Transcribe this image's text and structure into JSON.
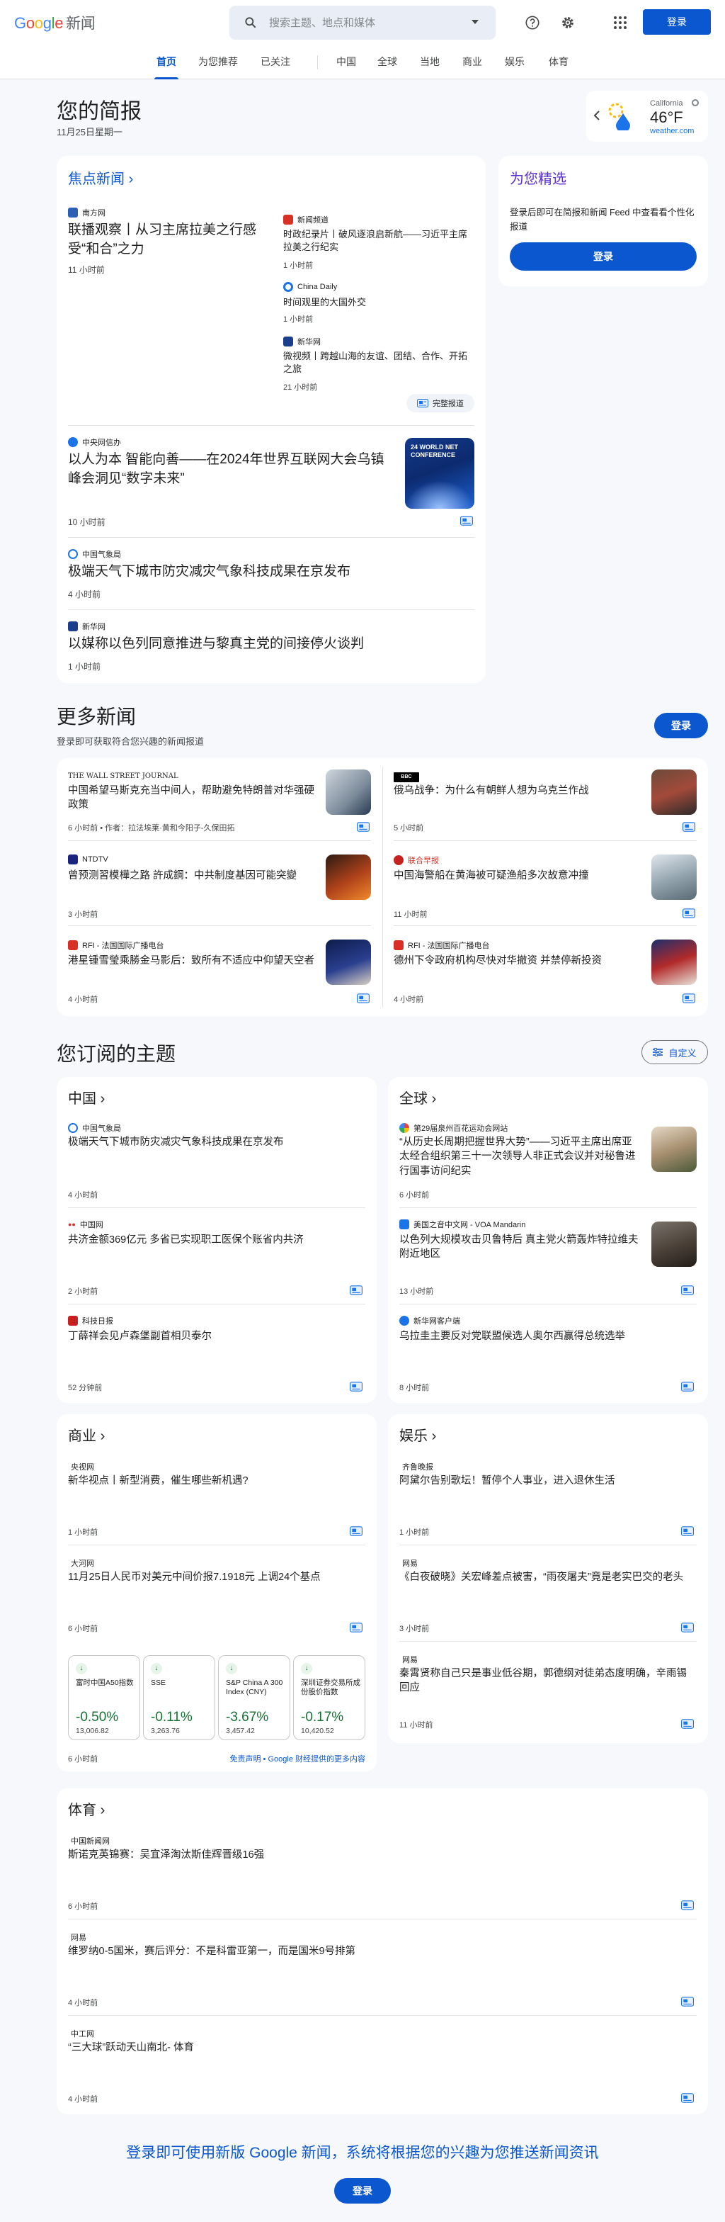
{
  "header": {
    "logo_letters": [
      "G",
      "o",
      "o",
      "g",
      "l",
      "e"
    ],
    "logo_suffix": "新闻",
    "search_placeholder": "搜索主题、地点和媒体",
    "login_label": "登录",
    "icons": [
      "search-icon",
      "help-icon",
      "gear-icon",
      "apps-icon",
      "chevron-down-icon"
    ]
  },
  "nav": {
    "tabs": [
      "首页",
      "为您推荐",
      "已关注",
      "中国",
      "全球",
      "当地",
      "商业",
      "娱乐",
      "体育"
    ],
    "active": "首页"
  },
  "briefing": {
    "title": "您的简报",
    "date": "11月25日星期一",
    "weather": {
      "location": "California",
      "temp": "46°F",
      "source": "weather.com"
    }
  },
  "top_stories": {
    "title": "焦点新闻",
    "full_coverage": "完整报道",
    "cluster": {
      "main": {
        "source": "南方网",
        "headline": "联播观察丨从习主席拉美之行感受“和合”之力",
        "time": "11 小时前"
      },
      "side": [
        {
          "source": "新闻频道",
          "headline": "时政纪录片丨破风逐浪启新航——习近平主席拉美之行纪实",
          "time": "1 小时前"
        },
        {
          "source": "China Daily",
          "headline": "时间观里的大国外交",
          "time": "1 小时前"
        },
        {
          "source": "新华网",
          "headline": "微视频丨跨越山海的友谊、团结、合作、开拓之旅",
          "time": "21 小时前"
        }
      ]
    },
    "stories": [
      {
        "source": "中央网信办",
        "headline": "以人为本 智能向善——在2024年世界互联网大会乌镇峰会洞见“数字未来”",
        "time": "10 小时前",
        "thumb_text": "24 WORLD NET CONFERENCE"
      },
      {
        "source": "中国气象局",
        "headline": "极端天气下城市防灾减灾气象科技成果在京发布",
        "time": "4 小时前"
      },
      {
        "source": "新华网",
        "headline": "以媒称以色列同意推进与黎真主党的间接停火谈判",
        "time": "1 小时前"
      }
    ]
  },
  "for_you": {
    "title": "为您精选",
    "text": "登录后即可在简报和新闻 Feed 中查看看个性化报道",
    "button": "登录"
  },
  "more_news": {
    "title": "更多新闻",
    "subtitle": "登录即可获取符合您兴趣的新闻报道",
    "button": "登录",
    "items": [
      {
        "source": "THE WALL STREET JOURNAL",
        "headline": "中国希望马斯克充当中间人，帮助避免特朗普对华强硬政策",
        "time": "6 小时前",
        "byline": "作者：拉法埃莱·黄和今阳子-久保田拓"
      },
      {
        "source": "BBC",
        "headline": "俄乌战争：为什么有朝鲜人想为乌克兰作战",
        "time": "5 小时前"
      },
      {
        "source": "NTDTV",
        "headline": "曾预测習模樺之路 許成鋼：中共制度基因可能突變",
        "time": "3 小时前"
      },
      {
        "source": "联合早报",
        "headline": "中国海警船在黄海被可疑渔船多次故意冲撞",
        "time": "11 小时前"
      },
      {
        "source": "RFI - 法国国际广播电台",
        "headline": "港星锺雪瑩乘勝金马影后：致所有不适应中仰望天空者",
        "time": "4 小时前"
      },
      {
        "source": "RFI - 法国国际广播电台",
        "headline": "德州下令政府机构尽快对华撤资 并禁停新投资",
        "time": "4 小时前"
      }
    ]
  },
  "topics": {
    "title": "您订阅的主题",
    "customize": "自定义",
    "china": {
      "title": "中国",
      "items": [
        {
          "source": "中国气象局",
          "headline": "极端天气下城市防灾减灾气象科技成果在京发布",
          "time": "4 小时前"
        },
        {
          "source": "中国网",
          "headline": "共济金额369亿元 多省已实现职工医保个账省内共济",
          "time": "2 小时前"
        },
        {
          "source": "科技日报",
          "headline": "丁薛祥会见卢森堡副首相贝泰尔",
          "time": "52 分钟前"
        }
      ]
    },
    "world": {
      "title": "全球",
      "items": [
        {
          "source": "第29届泉州百花运动会网站",
          "headline": "“从历史长周期把握世界大势”——习近平主席出席亚太经合组织第三十一次领导人非正式会议并对秘鲁进行国事访问纪实",
          "time": "6 小时前"
        },
        {
          "source": "美国之音中文网 - VOA Mandarin",
          "headline": "以色列大规模攻击贝鲁特后 真主党火箭轰炸特拉维夫附近地区",
          "time": "13 小时前"
        },
        {
          "source": "新华网客户端",
          "headline": "乌拉圭主要反对党联盟候选人奥尔西赢得总统选举",
          "time": "8 小时前"
        }
      ]
    },
    "business": {
      "title": "商业",
      "items": [
        {
          "source": "央视网",
          "headline": "新华视点丨新型消费，催生哪些新机遇?",
          "time": "1 小时前"
        },
        {
          "source": "大河网",
          "headline": "11月25日人民币对美元中间价报7.1918元 上调24个基点",
          "time": "6 小时前"
        }
      ],
      "stocks": [
        {
          "name": "富时中国A50指数",
          "change": "-0.50%",
          "value": "13,006.82"
        },
        {
          "name": "SSE",
          "change": "-0.11%",
          "value": "3,263.76"
        },
        {
          "name": "S&P China A 300 Index (CNY)",
          "change": "-3.67%",
          "value": "3,457.42"
        },
        {
          "name": "深圳证券交易所成份股价指数",
          "change": "-0.17%",
          "value": "10,420.52"
        }
      ],
      "stocks_time": "6 小时前",
      "disclaimer": "免责声明 • Google 财经提供的更多内容"
    },
    "entertainment": {
      "title": "娱乐",
      "items": [
        {
          "source": "齐鲁晚报",
          "headline": "阿黛尔告别歌坛！暂停个人事业，进入退休生活",
          "time": "1 小时前"
        },
        {
          "source": "网易",
          "headline": "《白夜破晓》关宏峰差点被害，“雨夜屠夫”竟是老实巴交的老头",
          "time": "3 小时前"
        },
        {
          "source": "网易",
          "headline": "秦霄贤称自己只是事业低谷期，郭德纲对徒弟态度明确，辛雨锡回应",
          "time": "11 小时前"
        }
      ]
    },
    "sports": {
      "title": "体育",
      "items": [
        {
          "source": "中国新闻网",
          "headline": "斯诺克英锦赛：吴宜泽淘汰斯佳辉晋级16强",
          "time": "6 小时前"
        },
        {
          "source": "网易",
          "headline": "维罗纳0-5国米，赛后评分：不是科雷亚第一，而是国米9号排第",
          "time": "4 小时前"
        },
        {
          "source": "中工网",
          "headline": "“三大球”跃动天山南北- 体育",
          "time": "4 小时前"
        }
      ]
    }
  },
  "footer": {
    "text": "登录即可使用新版 Google 新闻，系统将根据您的兴趣为您推送新闻资讯",
    "button": "登录"
  },
  "colors": {
    "accent": "#0b57d0",
    "positive": "#137333",
    "bg": "#f6f8fc"
  }
}
